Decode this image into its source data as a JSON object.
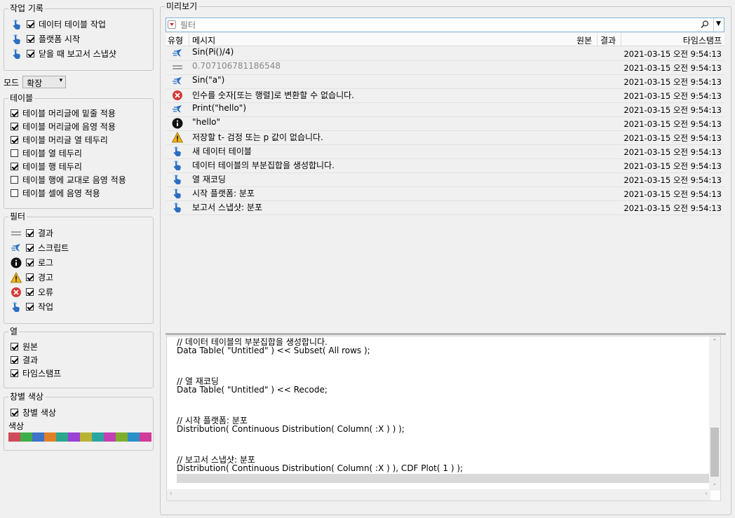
{
  "left": {
    "work_history": {
      "title": "작업 기록",
      "items": [
        {
          "label": "데이터 테이블 작업",
          "checked": true
        },
        {
          "label": "플랫폼 시작",
          "checked": true
        },
        {
          "label": "닫을 때 보고서 스냅샷",
          "checked": true
        }
      ]
    },
    "mode": {
      "label": "모드",
      "value": "확장"
    },
    "table": {
      "title": "테이블",
      "items": [
        {
          "label": "테이블 머리글에 밑줄 적용",
          "checked": true
        },
        {
          "label": "테이블 머리글에 음영 적용",
          "checked": true
        },
        {
          "label": "테이블 머리글 열 테두리",
          "checked": true
        },
        {
          "label": "테이블 열 테두리",
          "checked": false
        },
        {
          "label": "테이블 행 테두리",
          "checked": true
        },
        {
          "label": "테이블 행에 교대로 음영 적용",
          "checked": false
        },
        {
          "label": "테이블 셀에 음영 적용",
          "checked": false
        }
      ]
    },
    "filter": {
      "title": "필터",
      "items": [
        {
          "label": "결과",
          "icon": "result-icon",
          "checked": true
        },
        {
          "label": "스크립트",
          "icon": "script-icon",
          "checked": true
        },
        {
          "label": "로그",
          "icon": "info-icon",
          "checked": true
        },
        {
          "label": "경고",
          "icon": "warning-icon",
          "checked": true
        },
        {
          "label": "오류",
          "icon": "error-icon",
          "checked": true
        },
        {
          "label": "작업",
          "icon": "hand-icon",
          "checked": true
        }
      ]
    },
    "columns": {
      "title": "열",
      "items": [
        {
          "label": "원본",
          "checked": true
        },
        {
          "label": "결과",
          "checked": true
        },
        {
          "label": "타임스탬프",
          "checked": true
        }
      ]
    },
    "window_color": {
      "title": "창별 색상",
      "checkbox_label": "창별 색상",
      "checked": true,
      "color_label": "색상",
      "colors": [
        "#cf4b5a",
        "#3fae49",
        "#3d73c9",
        "#e0812a",
        "#2aa88e",
        "#9b3fd6",
        "#b9b334",
        "#2aa6a0",
        "#c33fb3",
        "#7fae2f",
        "#2b8fc9",
        "#d03c99"
      ]
    }
  },
  "preview": {
    "title": "미리보기",
    "search_placeholder": "필터",
    "headers": {
      "type": "유형",
      "message": "메시지",
      "source": "원본",
      "result": "결과",
      "timestamp": "타임스탬프"
    },
    "rows": [
      {
        "icon": "script-icon",
        "message": "Sin(Pi()/4)",
        "timestamp": "2021-03-15 오전 9:54:13"
      },
      {
        "icon": "result-icon",
        "message": "0.707106781186548",
        "timestamp": "2021-03-15 오전 9:54:13",
        "dim": true
      },
      {
        "icon": "script-icon",
        "message": "Sin(\"a\")",
        "timestamp": "2021-03-15 오전 9:54:13"
      },
      {
        "icon": "error-icon",
        "message": "인수를 숫자[또는 행렬]로 변환할 수 없습니다.",
        "timestamp": "2021-03-15 오전 9:54:13"
      },
      {
        "icon": "script-icon",
        "message": "Print(\"hello\")",
        "timestamp": "2021-03-15 오전 9:54:13"
      },
      {
        "icon": "info-icon",
        "message": "\"hello\"",
        "timestamp": "2021-03-15 오전 9:54:13"
      },
      {
        "icon": "warning-icon",
        "message": "저장할 t- 검정 또는 p 값이 없습니다.",
        "timestamp": "2021-03-15 오전 9:54:13"
      },
      {
        "icon": "hand-icon",
        "message": "새 데이터 테이블",
        "timestamp": "2021-03-15 오전 9:54:13"
      },
      {
        "icon": "hand-icon",
        "message": "데이터 테이블의 부분집합을 생성합니다.",
        "timestamp": "2021-03-15 오전 9:54:13"
      },
      {
        "icon": "hand-icon",
        "message": "열 재코딩",
        "timestamp": "2021-03-15 오전 9:54:13"
      },
      {
        "icon": "hand-icon",
        "message": "시작 플랫폼: 분포",
        "timestamp": "2021-03-15 오전 9:54:13"
      },
      {
        "icon": "hand-icon",
        "message": "보고서 스냅샷: 분포",
        "timestamp": "2021-03-15 오전 9:54:13"
      }
    ],
    "script_lines": [
      "// 데이터 테이블의 부분집합을 생성합니다.",
      "Data Table( \"Untitled\" ) << Subset( All rows );",
      "",
      "",
      "// 열 재코딩",
      "Data Table( \"Untitled\" ) << Recode;",
      "",
      "",
      "// 시작 플랫폼: 분포",
      "Distribution( Continuous Distribution( Column( :X ) ) );",
      "",
      "",
      "// 보고서 스냅샷: 분포",
      "Distribution( Continuous Distribution( Column( :X ) ), CDF Plot( 1 ) );"
    ]
  }
}
